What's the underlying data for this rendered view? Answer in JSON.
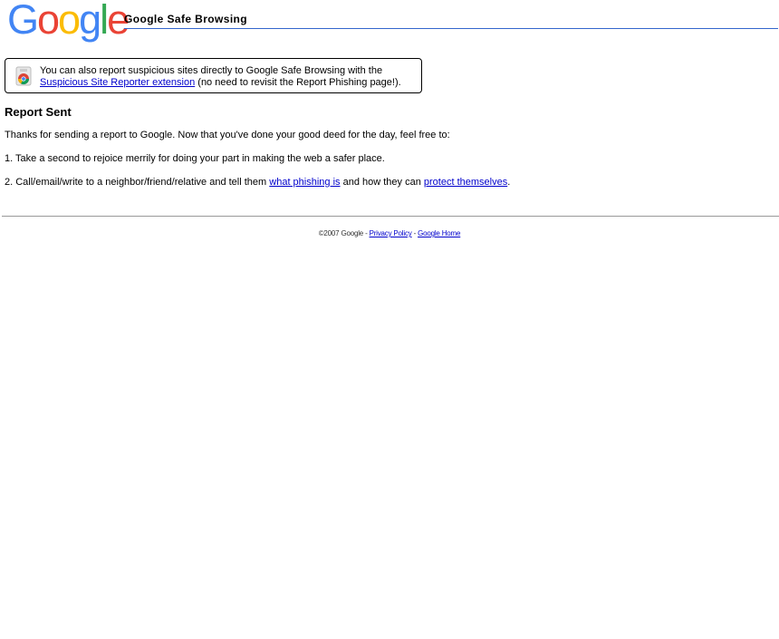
{
  "header": {
    "logo_letters": [
      "G",
      "o",
      "o",
      "g",
      "l",
      "e"
    ],
    "logo_colors": [
      "#4285F4",
      "#EA4335",
      "#FBBC05",
      "#4285F4",
      "#34A853",
      "#EA4335"
    ],
    "title": "Google Safe Browsing",
    "rule_color": "#3366cc"
  },
  "notice": {
    "icon": "chrome-extension-icon",
    "line1": "You can also report suspicious sites directly to Google Safe Browsing with the",
    "link": "Suspicious Site Reporter extension",
    "line2_suffix": " (no need to revisit the Report Phishing page!)."
  },
  "main": {
    "heading": "Report Sent",
    "intro": "Thanks for sending a report to Google. Now that you've done your good deed for the day, feel free to:",
    "item1": "1. Take a second to rejoice merrily for doing your part in making the web a safer place.",
    "item2_prefix": "2. Call/email/write to a neighbor/friend/relative and tell them ",
    "item2_link1": "what phishing is",
    "item2_middle": " and how they can ",
    "item2_link2": "protect themselves",
    "item2_suffix": "."
  },
  "footer": {
    "copyright": "©2007 Google - ",
    "privacy_link": "Privacy Policy",
    "separator": " - ",
    "home_link": "Google Home"
  },
  "colors": {
    "link": "#0000cc",
    "divider": "#999999"
  }
}
